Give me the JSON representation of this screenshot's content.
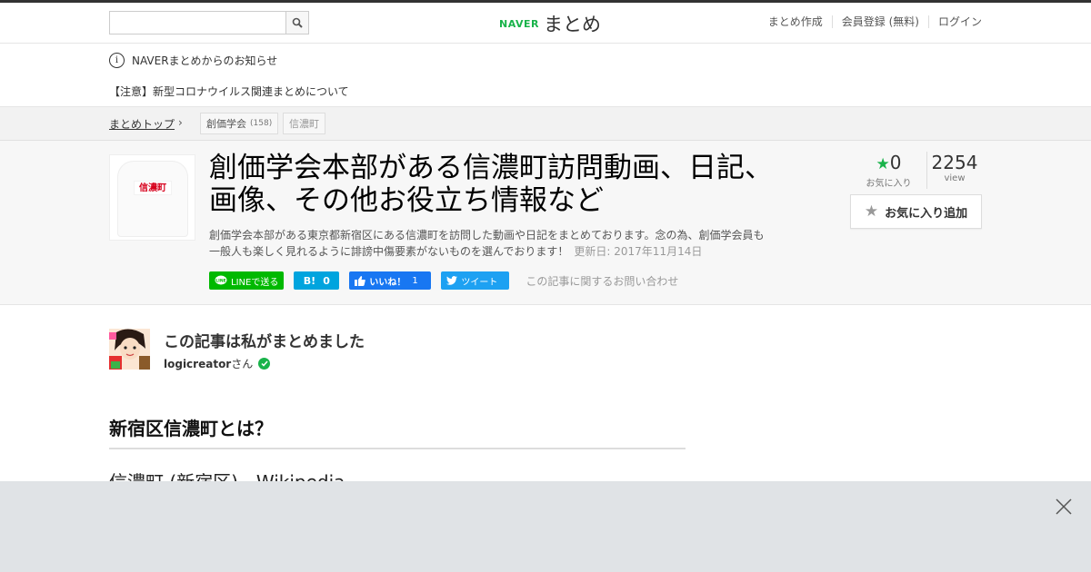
{
  "header": {
    "search_placeholder": "",
    "logo_brand": "NAVER",
    "logo_name": "まとめ",
    "nav": [
      "まとめ作成",
      "会員登録 (無料)",
      "ログイン"
    ]
  },
  "notice": {
    "title": "NAVERまとめからのお知らせ",
    "item": "【注意】新型コロナウイルス関連まとめについて"
  },
  "breadcrumb": {
    "top": "まとめトップ",
    "tags": [
      {
        "label": "創価学会",
        "count": "(158)"
      },
      {
        "label": "信濃町"
      }
    ]
  },
  "article": {
    "thumb_label": "信濃町",
    "title": "創価学会本部がある信濃町訪問動画、日記、画像、その他お役立ち情報など",
    "description": "創価学会本部がある東京都新宿区にある信濃町を訪問した動画や日記をまとめております。念の為、創価学会員も一般人も楽しく見れるように誹謗中傷要素がないものを選んでおります！",
    "updated": "更新日: 2017年11月14日",
    "favorites": "0",
    "favorites_label": "お気に入り",
    "views": "2254",
    "views_label": "view",
    "fav_button": "お気に入り追加",
    "share": {
      "line": "LINEで送る",
      "hatena_icon": "B!",
      "hatena_count": "0",
      "fb_label": "いいね！",
      "fb_count": "1",
      "tweet": "ツイート"
    },
    "contact": "この記事に関するお問い合わせ"
  },
  "author": {
    "heading": "この記事は私がまとめました",
    "username": "logicreator",
    "suffix": "さん"
  },
  "section": {
    "heading": "新宿区信濃町とは？",
    "link": "信濃町 (新宿区) - Wikipedia"
  },
  "colors": {
    "naver_green": "#19b34a",
    "line_green": "#00b900",
    "hatena_blue": "#00a4de",
    "fb_blue": "#1877f2",
    "twitter_blue": "#1da1f2"
  }
}
